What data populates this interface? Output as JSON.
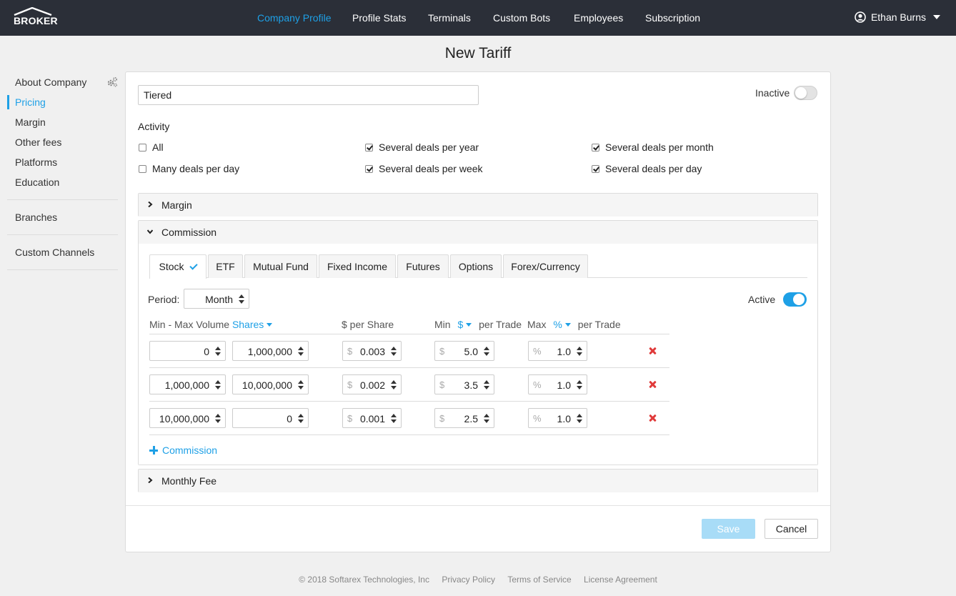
{
  "brand": {
    "logo_text": "BROKER"
  },
  "nav": {
    "items": [
      {
        "label": "Company Profile",
        "active": true
      },
      {
        "label": "Profile Stats"
      },
      {
        "label": "Terminals"
      },
      {
        "label": "Custom Bots"
      },
      {
        "label": "Employees"
      },
      {
        "label": "Subscription"
      }
    ],
    "user": "Ethan Burns"
  },
  "page_title": "New Tariff",
  "sidebar": {
    "group1": [
      "About Company",
      "Pricing",
      "Margin",
      "Other fees",
      "Platforms",
      "Education"
    ],
    "group2": [
      "Branches"
    ],
    "group3": [
      "Custom Channels"
    ],
    "active": "Pricing"
  },
  "tariff": {
    "name_value": "Tiered",
    "status_label": "Inactive",
    "status_on": false
  },
  "activity": {
    "label": "Activity",
    "options": [
      {
        "label": "All",
        "checked": false
      },
      {
        "label": "Several deals per year",
        "checked": true
      },
      {
        "label": "Several deals per month",
        "checked": true
      },
      {
        "label": "Many deals per day",
        "checked": false
      },
      {
        "label": "Several deals per week",
        "checked": true
      },
      {
        "label": "Several deals per day",
        "checked": true
      }
    ]
  },
  "sections": {
    "margin": "Margin",
    "commission": "Commission",
    "monthly_fee": "Monthly Fee"
  },
  "commission": {
    "tabs": [
      "Stock",
      "ETF",
      "Mutual Fund",
      "Fixed Income",
      "Futures",
      "Options",
      "Forex/Currency"
    ],
    "active_tab": "Stock",
    "period_label": "Period:",
    "period_value": "Month",
    "active_label": "Active",
    "active_on": true,
    "headers": {
      "volume": "Min - Max Volume",
      "volume_unit": "Shares",
      "per_share": "$ per Share",
      "min": "Min",
      "min_unit": "$",
      "min_suffix": "per Trade",
      "max": "Max",
      "max_unit": "%",
      "max_suffix": "per Trade"
    },
    "currency_symbol": "$",
    "percent_symbol": "%",
    "rows": [
      {
        "min_volume": "0",
        "max_volume": "1,000,000",
        "per_share": "0.003",
        "min_trade": "5.0",
        "max_trade": "1.0"
      },
      {
        "min_volume": "1,000,000",
        "max_volume": "10,000,000",
        "per_share": "0.002",
        "min_trade": "3.5",
        "max_trade": "1.0"
      },
      {
        "min_volume": "10,000,000",
        "max_volume": "0",
        "per_share": "0.001",
        "min_trade": "2.5",
        "max_trade": "1.0"
      }
    ],
    "add_label": "Commission"
  },
  "actions": {
    "save": "Save",
    "cancel": "Cancel"
  },
  "footer": {
    "copyright": "© 2018 Softarex Technologies, Inc",
    "links": [
      "Privacy Policy",
      "Terms of Service",
      "License Agreement"
    ]
  },
  "colors": {
    "accent": "#1ea0e6",
    "topbar": "#2b2f38",
    "danger": "#e03a3a"
  }
}
